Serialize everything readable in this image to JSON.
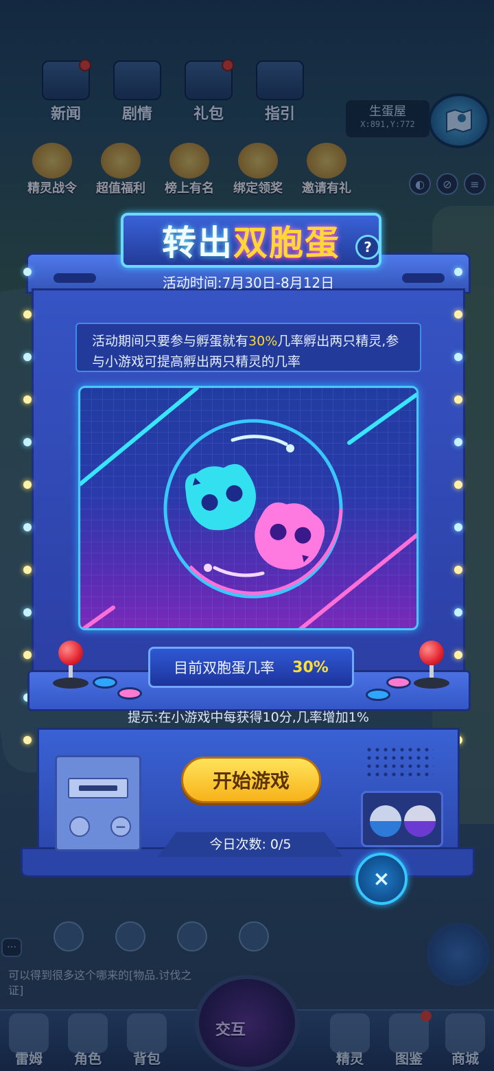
{
  "top_menu": [
    {
      "label": "新闻",
      "icon": "tv-icon",
      "badge": true
    },
    {
      "label": "剧情",
      "icon": "book-icon",
      "badge": false
    },
    {
      "label": "礼包",
      "icon": "chest-icon",
      "badge": true
    },
    {
      "label": "指引",
      "icon": "guide-icon",
      "badge": false
    }
  ],
  "location": {
    "name": "生蛋屋",
    "coords": "X:891,Y:772"
  },
  "activities": [
    "精灵战令",
    "超值福利",
    "榜上有名",
    "绑定领奖",
    "邀请有礼"
  ],
  "popup": {
    "title_part1": "转出",
    "title_part2": "双胞蛋",
    "help": "?",
    "time": "活动时间:7月30日-8月12日",
    "desc_before": "活动期间只要参与孵蛋就有",
    "desc_highlight": "30%",
    "desc_after": "几率孵出两只精灵,参与小游戏可提高孵出两只精灵的几率",
    "rate_label": "目前双胞蛋几率",
    "rate_value": "30%",
    "hint": "提示:在小游戏中每获得10分,几率增加1%",
    "start_button": "开始游戏",
    "daily_count": "今日次数: 0/5",
    "close": "×"
  },
  "chat": {
    "text": "可以得到很多这个哪来的[物品.讨伐之证]"
  },
  "bottom_nav": [
    {
      "label": "雷姆",
      "badge": false
    },
    {
      "label": "角色",
      "badge": false
    },
    {
      "label": "背包",
      "badge": false
    },
    {
      "label": "精灵",
      "badge": false
    },
    {
      "label": "图鉴",
      "badge": true
    },
    {
      "label": "商城",
      "badge": false
    }
  ],
  "center_nav": {
    "label": "交互"
  },
  "colors": {
    "accent_cyan": "#4bc8ff",
    "accent_yellow": "#ffd838",
    "pink": "#ff6fd8",
    "cyan_face": "#33e0f0"
  }
}
